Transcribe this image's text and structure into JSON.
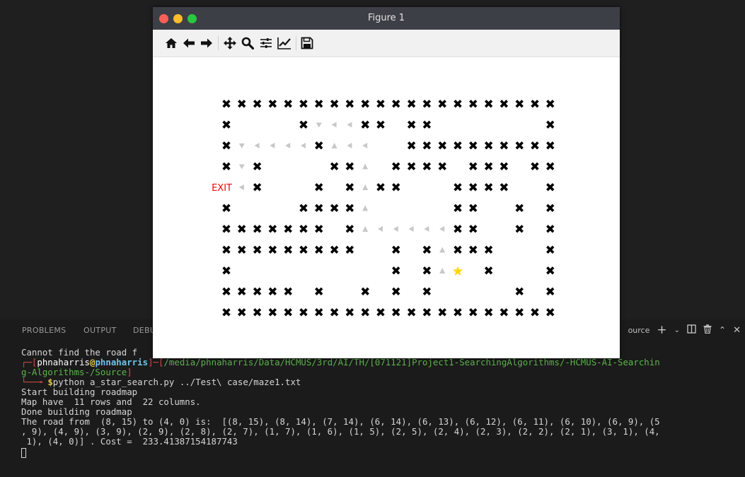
{
  "window": {
    "title": "Figure 1",
    "toolbar": [
      "home-icon",
      "back-icon",
      "forward-icon",
      "pan-icon",
      "zoom-icon",
      "configure-subplots-icon",
      "edit-axes-icon",
      "save-icon"
    ]
  },
  "maze": {
    "rows": [
      "XXXXXXXXXXXXXXXXXXXXXX",
      "X    XV<<XX XX       X",
      "XV<<<<XA<<  XXXXXXXXXX",
      "XVX    XXA XXXX XXX XX",
      "E<X   X XAXX   XXXX  X",
      "X    XXXXA     XX  X X",
      "XXXXXXX XA<<<<<XX  X X",
      "XXXXXXXXX  X XAXXX   X",
      "X          X XAS X   X",
      "XXXXX X  X X X     X X",
      "XXXXXXXXXXXXXXXXXXXXXX"
    ],
    "exit_label": "EXIT",
    "colors": {
      "wall": "#000000",
      "path": "#c8c8c8",
      "exit": "#ff0000",
      "start": "#ffd700"
    }
  },
  "panel": {
    "tabs": [
      "PROBLEMS",
      "OUTPUT",
      "DEBU"
    ],
    "right_label": "ource"
  },
  "terminal": {
    "line1": "Cannot find the road f",
    "prompt": {
      "user": "phnaharris",
      "at": "@",
      "host": "phnaharris",
      "path_line1": "/media/phnaharris/Data/HCMUS/3rd/AI/TH/[071121]Project1-SearchingAlgorithms/-HCMUS-AI-Searchin",
      "path_line2": "g-Algorithms-/Source"
    },
    "command": "python a_star_search.py ../Test\\ case/maze1.txt",
    "output": [
      "Start building roadmap",
      "Map have  11 rows and  22 columns.",
      "Done building roadmap",
      "The road from  (8, 15) to (4, 0) is:  [(8, 15), (8, 14), (7, 14), (6, 14), (6, 13), (6, 12), (6, 11), (6, 10), (6, 9), (5",
      ", 9), (4, 9), (3, 9), (2, 9), (2, 8), (2, 7), (1, 7), (1, 6), (1, 5), (2, 5), (2, 4), (2, 3), (2, 2), (2, 1), (3, 1), (4,",
      " 1), (4, 0)] . Cost =  233.41387154187743"
    ]
  }
}
